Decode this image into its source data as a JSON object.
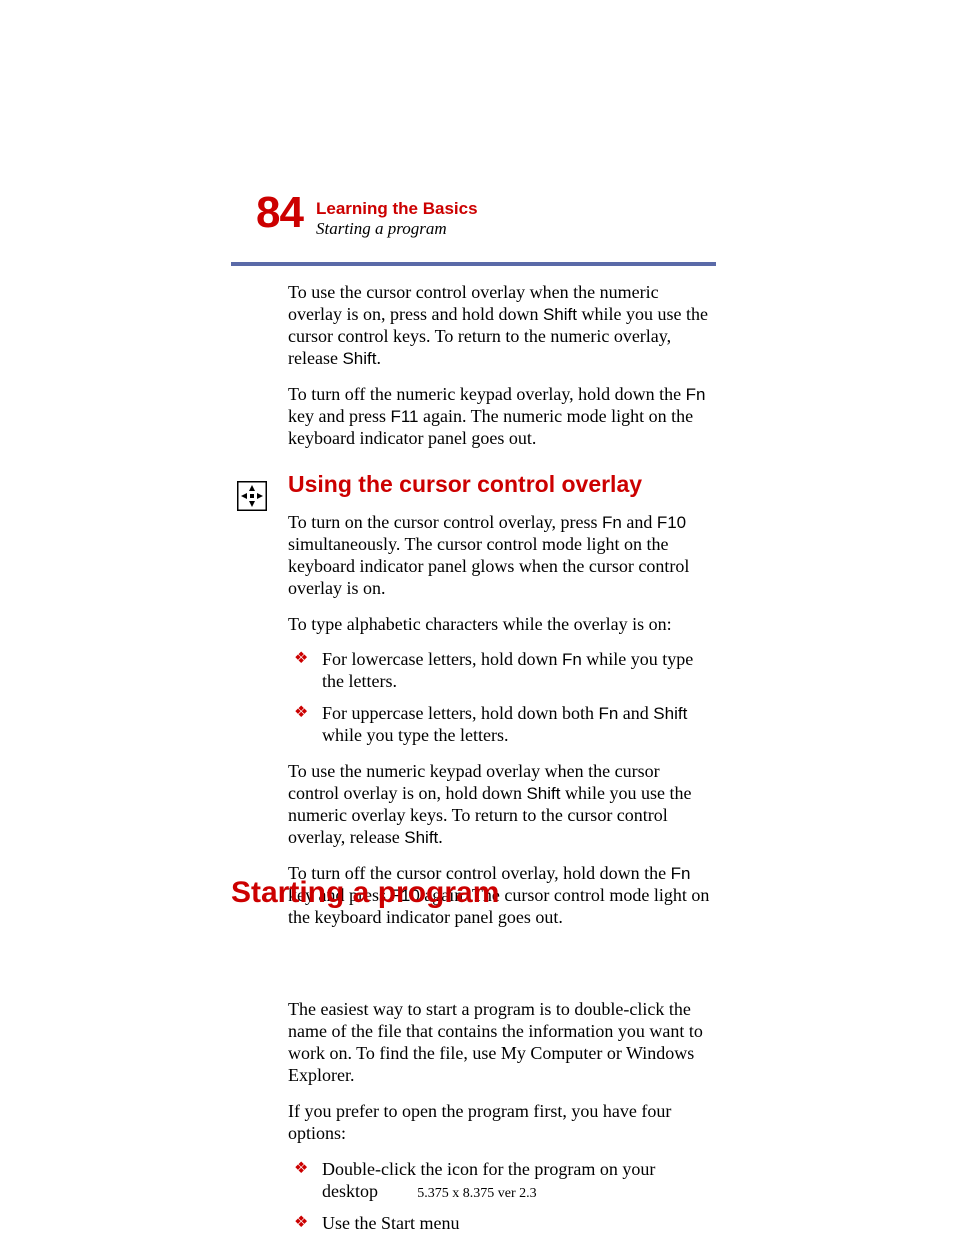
{
  "pageNumber": "84",
  "chapterTitle": "Learning the Basics",
  "sectionSubtitle": "Starting a program",
  "para1_a": "To use the cursor control overlay when the numeric overlay is on, press and hold down ",
  "para1_key1": "Shift",
  "para1_b": " while you use the cursor control keys. To return to the numeric overlay, release ",
  "para1_key2": "Shift",
  "para1_c": ".",
  "para2_a": "To turn off the numeric keypad overlay, hold down the ",
  "para2_key1": "Fn",
  "para2_b": " key and press ",
  "para2_key2": "F11",
  "para2_c": " again. The numeric mode light on the keyboard indicator panel goes out.",
  "heading2": "Using the cursor control overlay",
  "para3_a": "To turn on the cursor control overlay, press ",
  "para3_key1": "Fn",
  "para3_b": " and ",
  "para3_key2": "F10",
  "para3_c": " simultaneously. The cursor control mode light on the keyboard indicator panel glows when the cursor control overlay is on.",
  "para4": "To type alphabetic characters while the overlay is on:",
  "li1_a": "For lowercase letters, hold down ",
  "li1_key1": "Fn",
  "li1_b": " while you type the letters.",
  "li2_a": "For uppercase letters, hold down both ",
  "li2_key1": "Fn",
  "li2_b": " and ",
  "li2_key2": "Shift",
  "li2_c": " while you type the letters.",
  "para5_a": "To use the numeric keypad overlay when the cursor control overlay is on, hold down ",
  "para5_key1": "Shift",
  "para5_b": " while you use the numeric overlay keys. To return to the cursor control overlay, release ",
  "para5_key2": "Shift",
  "para5_c": ".",
  "para6_a": "To turn off the cursor control overlay, hold down the ",
  "para6_key1": "Fn",
  "para6_b": " key and press ",
  "para6_key2": "F10",
  "para6_c": " again. The cursor control mode light on the keyboard indicator panel goes out.",
  "heading1": "Starting a program",
  "para7": "The easiest way to start a program is to double-click the name of the file that contains the information you want to work on. To find the file, use My Computer or Windows Explorer.",
  "para8": "If you prefer to open the program first, you have four options:",
  "li3": "Double-click the icon for the program on your desktop",
  "li4": "Use the Start menu",
  "footer": "5.375 x 8.375 ver 2.3"
}
